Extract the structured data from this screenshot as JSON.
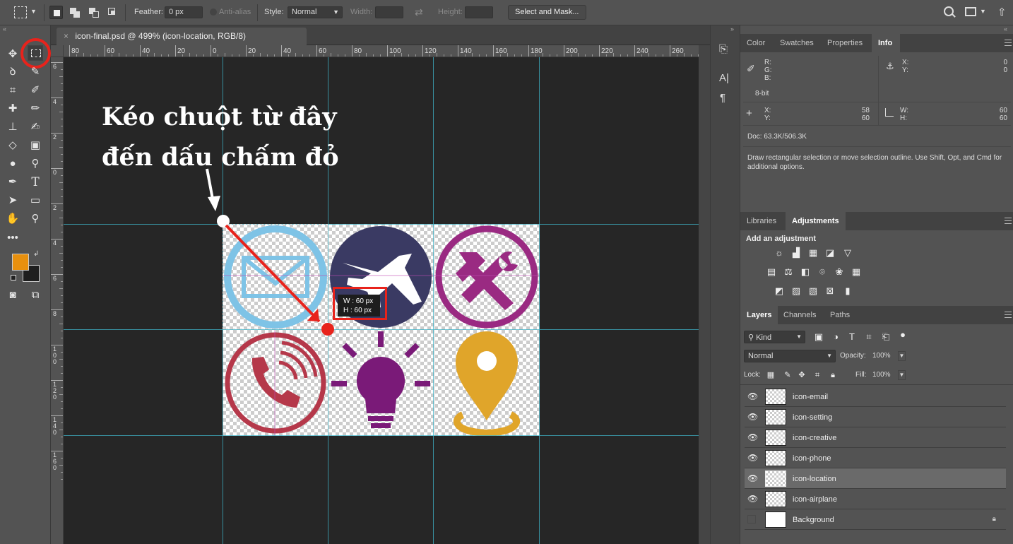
{
  "options_bar": {
    "feather_label": "Feather:",
    "feather_value": "0 px",
    "antialias_label": "Anti-alias",
    "style_label": "Style:",
    "style_value": "Normal",
    "width_label": "Width:",
    "height_label": "Height:",
    "select_mask_label": "Select and Mask..."
  },
  "document_tab": {
    "title": "icon-final.psd @ 499% (icon-location, RGB/8)",
    "close_glyph": "×"
  },
  "ruler_top": [
    "80",
    "60",
    "40",
    "20",
    "0",
    "20",
    "40",
    "60",
    "80",
    "100",
    "120",
    "140",
    "160",
    "180",
    "200",
    "220",
    "240",
    "260"
  ],
  "ruler_left": [
    "6",
    "4",
    "2",
    "0",
    "2",
    "4",
    "6",
    "8",
    "1\n0\n0",
    "1\n2\n0",
    "1\n4\n0",
    "1\n6\n0"
  ],
  "annotation": {
    "line1": "Kéo chuột từ đây",
    "line2": "đến dấu chấm đỏ"
  },
  "selection_readout": {
    "w": "W : 60 px",
    "h": "H : 60 px"
  },
  "colors": {
    "foreground": "#e8900e",
    "background": "#1e1e1e",
    "guide": "#3fb3c7",
    "accent_red": "#e8231c",
    "icon_blue": "#7ec3e6",
    "icon_navy": "#3a3a63",
    "icon_purple": "#9a2a82",
    "icon_red": "#b5384a",
    "icon_violet": "#7a1a78",
    "icon_gold": "#e0a52a"
  },
  "info_panel": {
    "tabs": [
      "Color",
      "Swatches",
      "Properties",
      "Info"
    ],
    "r_label": "R:",
    "g_label": "G:",
    "b_label": "B:",
    "bit_depth": "8-bit",
    "x_label": "X:",
    "y_label": "Y:",
    "top_x_value": "0",
    "top_y_value": "0",
    "cursor_x": "58",
    "cursor_y": "60",
    "w_label": "W:",
    "h_label": "H:",
    "sel_w": "60",
    "sel_h": "60",
    "doc_size": "Doc: 63.3K/506.3K",
    "hint": "Draw rectangular selection or move selection outline.  Use Shift, Opt, and Cmd for additional options."
  },
  "adjustments_panel": {
    "tabs": [
      "Libraries",
      "Adjustments"
    ],
    "heading": "Add an adjustment"
  },
  "layers_panel": {
    "tabs": [
      "Layers",
      "Channels",
      "Paths"
    ],
    "filter_kind": "Kind",
    "blend_mode": "Normal",
    "opacity_label": "Opacity:",
    "opacity_value": "100%",
    "lock_label": "Lock:",
    "fill_label": "Fill:",
    "fill_value": "100%",
    "layers": [
      {
        "name": "icon-email"
      },
      {
        "name": "icon-setting"
      },
      {
        "name": "icon-creative"
      },
      {
        "name": "icon-phone"
      },
      {
        "name": "icon-location"
      },
      {
        "name": "icon-airplane"
      },
      {
        "name": "Background"
      }
    ]
  }
}
